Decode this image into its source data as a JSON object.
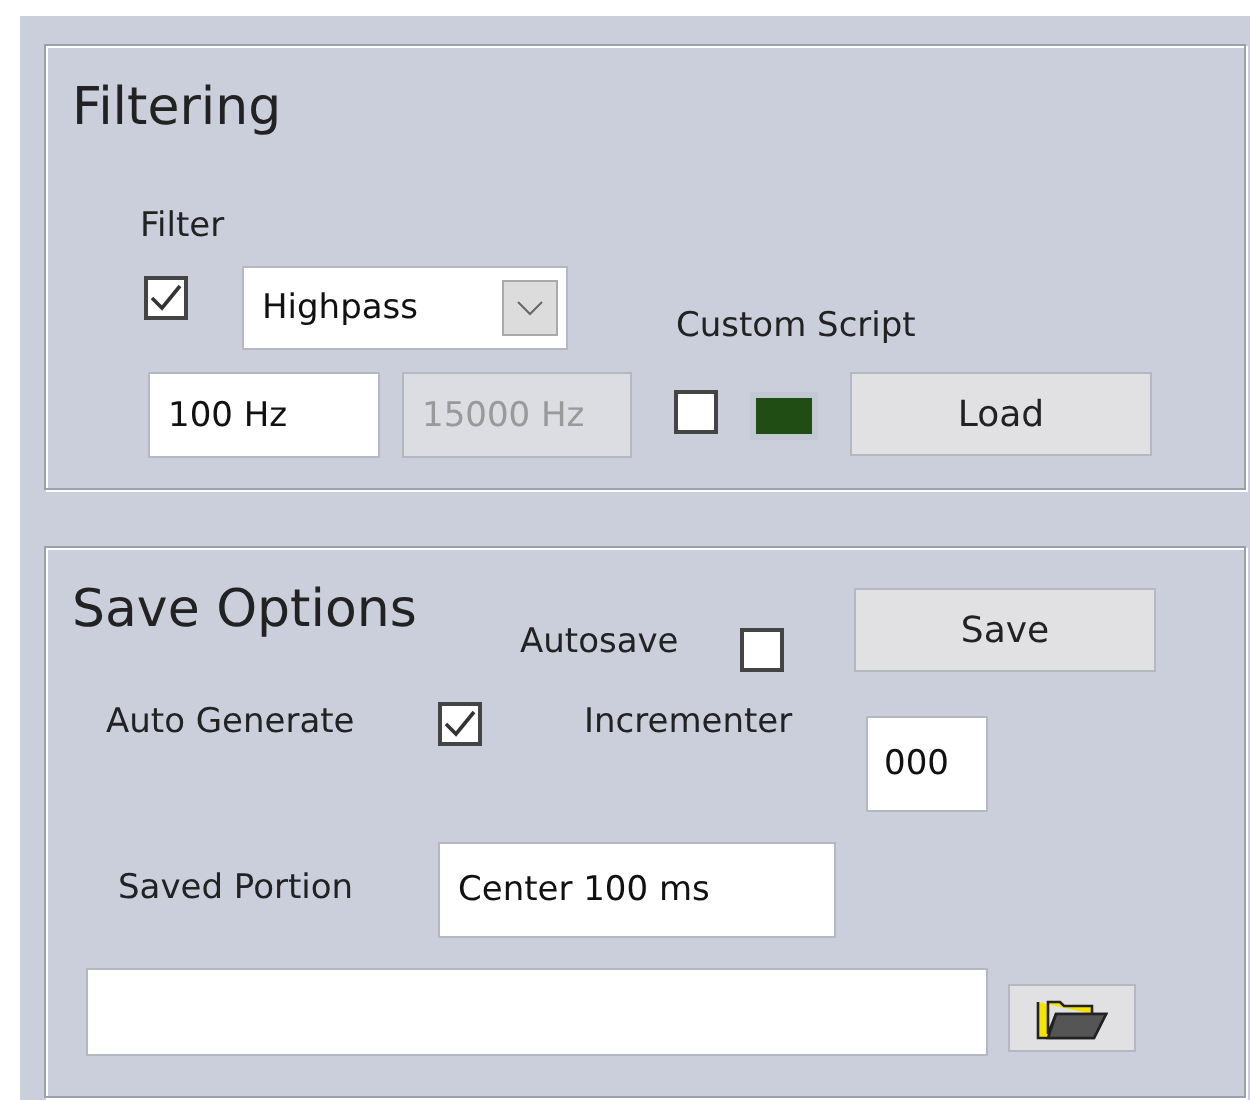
{
  "filtering": {
    "title": "Filtering",
    "filter_label": "Filter",
    "filter_enabled": {
      "checked": true
    },
    "filter_type": {
      "value": "Highpass"
    },
    "low_cutoff": {
      "value": "100 Hz",
      "disabled": false
    },
    "high_cutoff": {
      "value": "15000 Hz",
      "disabled": true
    },
    "custom_script": {
      "label": "Custom Script",
      "checked": false,
      "led_on": false,
      "button": "Load"
    }
  },
  "save_options": {
    "title": "Save Options",
    "autosave": {
      "label": "Autosave",
      "checked": false
    },
    "save_button": "Save",
    "auto_generate": {
      "label": "Auto Generate",
      "checked": true
    },
    "incrementer": {
      "label": "Incrementer",
      "value": "000"
    },
    "saved_portion": {
      "label": "Saved Portion",
      "value": "Center 100 ms"
    }
  }
}
